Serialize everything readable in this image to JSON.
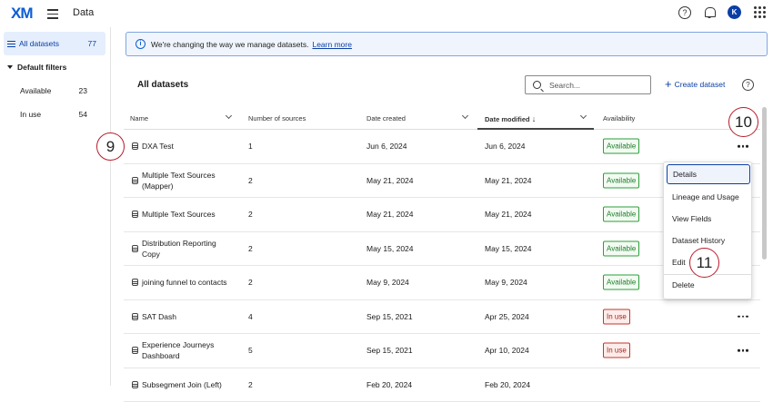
{
  "topbar": {
    "logo": "XM",
    "app_title": "Data",
    "help": "?",
    "avatar": "K"
  },
  "sidebar": {
    "all": {
      "label": "All datasets",
      "count": "77"
    },
    "group_label": "Default filters",
    "items": [
      {
        "label": "Available",
        "count": "23"
      },
      {
        "label": "In use",
        "count": "54"
      }
    ]
  },
  "banner": {
    "text": "We're changing the way we manage datasets.",
    "link": "Learn more",
    "icon": "i"
  },
  "section_title": "All datasets",
  "search": {
    "placeholder": "Search..."
  },
  "create_label": "Create dataset",
  "help_icon": "?",
  "table": {
    "headers": {
      "name": "Name",
      "sources": "Number of sources",
      "created": "Date created",
      "modified": "Date modified",
      "sort_arrow": "↓",
      "availability": "Availability"
    },
    "rows": [
      {
        "name": "DXA Test",
        "sources": "1",
        "created": "Jun 6, 2024",
        "modified": "Jun 6, 2024",
        "availability": "Available",
        "status": "available"
      },
      {
        "name": "Multiple Text Sources (Mapper)",
        "sources": "2",
        "created": "May 21, 2024",
        "modified": "May 21, 2024",
        "availability": "Available",
        "status": "available"
      },
      {
        "name": "Multiple Text Sources",
        "sources": "2",
        "created": "May 21, 2024",
        "modified": "May 21, 2024",
        "availability": "Available",
        "status": "available"
      },
      {
        "name": "Distribution Reporting Copy",
        "sources": "2",
        "created": "May 15, 2024",
        "modified": "May 15, 2024",
        "availability": "Available",
        "status": "available"
      },
      {
        "name": "joining funnel to contacts",
        "sources": "2",
        "created": "May 9, 2024",
        "modified": "May 9, 2024",
        "availability": "Available",
        "status": "available"
      },
      {
        "name": "SAT Dash",
        "sources": "4",
        "created": "Sep 15, 2021",
        "modified": "Apr 25, 2024",
        "availability": "In use",
        "status": "inuse"
      },
      {
        "name": "Experience Journeys Dashboard",
        "sources": "5",
        "created": "Sep 15, 2021",
        "modified": "Apr 10, 2024",
        "availability": "In use",
        "status": "inuse"
      },
      {
        "name": "Subsegment Join (Left)",
        "sources": "2",
        "created": "Feb 20, 2024",
        "modified": "Feb 20, 2024",
        "availability": "",
        "status": "none"
      }
    ]
  },
  "context_menu": {
    "items": [
      "Details",
      "Lineage and Usage",
      "View Fields",
      "Dataset History",
      "Edit",
      "Delete"
    ]
  },
  "callouts": {
    "step9": "9",
    "step10": "10",
    "step11": "11"
  },
  "colors": {
    "accent": "#0b3fa5",
    "available": "#2e9e3b",
    "in_use": "#c0392b",
    "callout": "#b71c2b"
  }
}
